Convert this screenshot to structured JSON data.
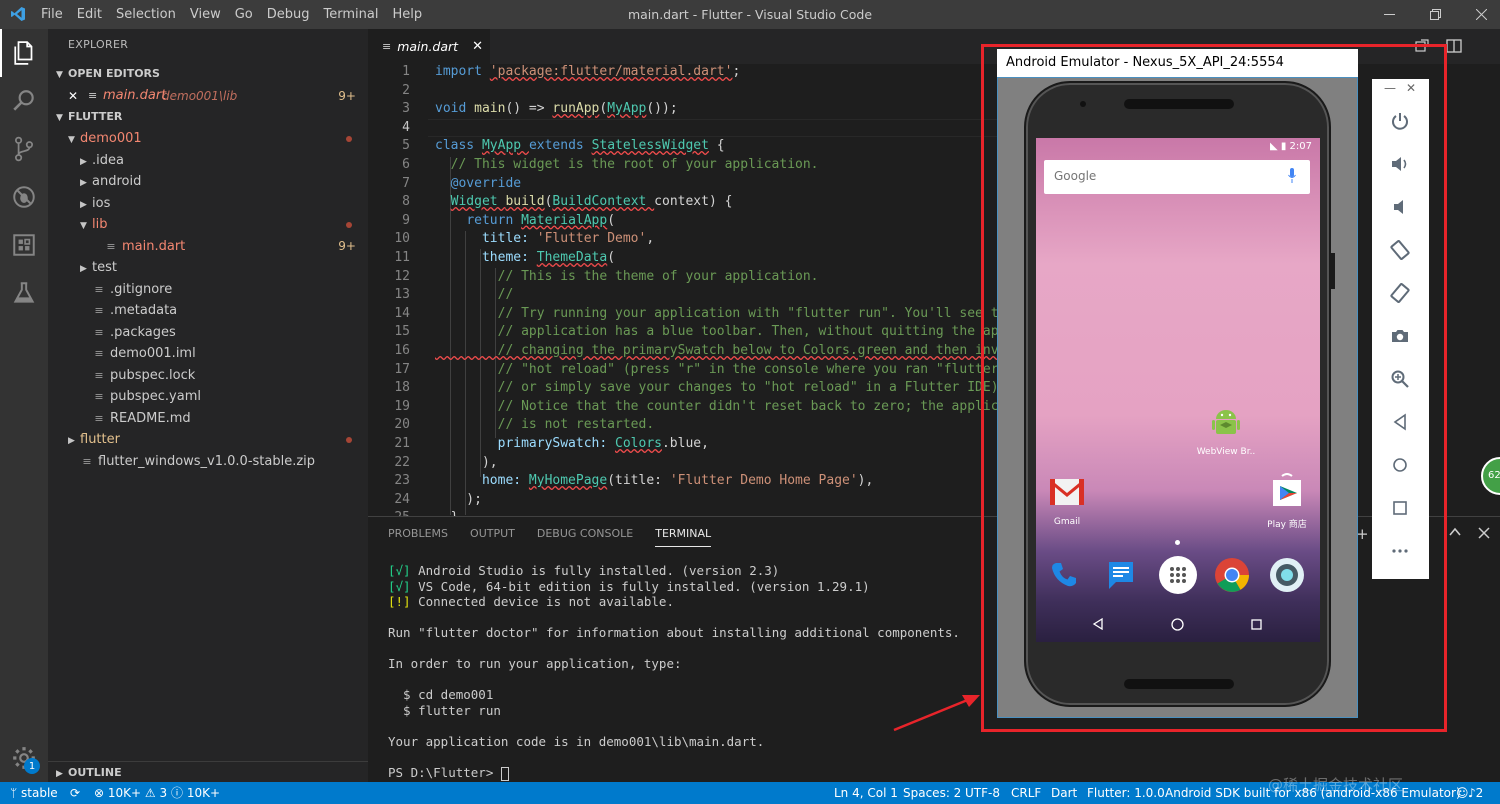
{
  "titlebar": {
    "menu": [
      "File",
      "Edit",
      "Selection",
      "View",
      "Go",
      "Debug",
      "Terminal",
      "Help"
    ],
    "title": "main.dart - Flutter - Visual Studio Code"
  },
  "sidebar": {
    "title": "EXPLORER",
    "open_editors_label": "OPEN EDITORS",
    "open_editor": {
      "name": "main.dart",
      "path": "demo001\\lib",
      "badge": "9+"
    },
    "flutter_label": "FLUTTER",
    "outline_label": "OUTLINE",
    "tree": [
      {
        "name": "demo001",
        "indent": 1,
        "type": "folder-open",
        "color": "red",
        "dot": true
      },
      {
        "name": ".idea",
        "indent": 2,
        "type": "folder"
      },
      {
        "name": "android",
        "indent": 2,
        "type": "folder"
      },
      {
        "name": "ios",
        "indent": 2,
        "type": "folder"
      },
      {
        "name": "lib",
        "indent": 2,
        "type": "folder-open",
        "color": "red",
        "dot": true
      },
      {
        "name": "main.dart",
        "indent": 3,
        "type": "file",
        "color": "red",
        "badge": "9+"
      },
      {
        "name": "test",
        "indent": 2,
        "type": "folder"
      },
      {
        "name": ".gitignore",
        "indent": 2,
        "type": "file"
      },
      {
        "name": ".metadata",
        "indent": 2,
        "type": "file"
      },
      {
        "name": ".packages",
        "indent": 2,
        "type": "file"
      },
      {
        "name": "demo001.iml",
        "indent": 2,
        "type": "file"
      },
      {
        "name": "pubspec.lock",
        "indent": 2,
        "type": "file"
      },
      {
        "name": "pubspec.yaml",
        "indent": 2,
        "type": "file"
      },
      {
        "name": "README.md",
        "indent": 2,
        "type": "file"
      },
      {
        "name": "flutter",
        "indent": 1,
        "type": "folder",
        "color": "mod",
        "dot": true
      },
      {
        "name": "flutter_windows_v1.0.0-stable.zip",
        "indent": 1,
        "type": "file"
      }
    ],
    "accounts_badge": "1"
  },
  "tab": {
    "label": "main.dart"
  },
  "editor": {
    "lines": [
      [
        "import ",
        "kw",
        "'package:flutter/material.dart'",
        "str",
        ";",
        ""
      ],
      [],
      [
        "void ",
        "kw",
        "main",
        "fn",
        "() => ",
        "",
        "runApp",
        "fn",
        "(",
        "",
        "MyApp",
        "ty",
        "());",
        ""
      ],
      [],
      [
        "class ",
        "kw",
        "MyApp ",
        "ty",
        "extends ",
        "kw",
        "StatelessWidget",
        "ty",
        " {",
        ""
      ],
      [
        "  // This widget is the root of your application.",
        "cm"
      ],
      [
        "  ",
        "",
        "@override",
        "kw"
      ],
      [
        "  ",
        "",
        "Widget ",
        "ty",
        "build",
        "fn",
        "(",
        "",
        "BuildContext ",
        "ty",
        "context) {",
        ""
      ],
      [
        "    ",
        "",
        "return ",
        "kw",
        "MaterialApp",
        "ty",
        "(",
        ""
      ],
      [
        "      title: ",
        "pm",
        "'Flutter Demo'",
        "str",
        ",",
        ""
      ],
      [
        "      theme: ",
        "pm",
        "ThemeData",
        "ty",
        "(",
        ""
      ],
      [
        "        // This is the theme of your application.",
        "cm"
      ],
      [
        "        //",
        "cm"
      ],
      [
        "        // Try running your application with \"flutter run\". You'll see the",
        "cm"
      ],
      [
        "        // application has a blue toolbar. Then, without quitting the app,",
        "cm"
      ],
      [
        "        // changing the primarySwatch below to Colors.green and then invoke",
        "cm"
      ],
      [
        "        // \"hot reload\" (press \"r\" in the console where you ran \"flutter ru",
        "cm"
      ],
      [
        "        // or simply save your changes to \"hot reload\" in a Flutter IDE).",
        "cm"
      ],
      [
        "        // Notice that the counter didn't reset back to zero; the applicati",
        "cm"
      ],
      [
        "        // is not restarted.",
        "cm"
      ],
      [
        "        primarySwatch: ",
        "pm",
        "Colors",
        "ty",
        ".blue,",
        ""
      ],
      [
        "      ),",
        ""
      ],
      [
        "      home: ",
        "pm",
        "MyHomePage",
        "ty",
        "(title: ",
        "",
        "'Flutter Demo Home Page'",
        "str",
        "),",
        ""
      ],
      [
        "    );",
        ""
      ],
      [
        "  }",
        ""
      ]
    ]
  },
  "panel": {
    "tabs": [
      "PROBLEMS",
      "OUTPUT",
      "DEBUG CONSOLE",
      "TERMINAL"
    ],
    "active_tab": "TERMINAL",
    "terminal": [
      [
        "[√]",
        "tgreen",
        " Android Studio is fully installed. (version 2.3)",
        ""
      ],
      [
        "[√]",
        "tgreen",
        " VS Code, 64-bit edition is fully installed. (version 1.29.1)",
        ""
      ],
      [
        "[!]",
        "tyellow",
        " Connected device is not available.",
        ""
      ],
      [],
      [
        "Run \"flutter doctor\" for information about installing additional components.",
        ""
      ],
      [],
      [
        "In order to run your application, type:",
        ""
      ],
      [],
      [
        "  $ cd demo001",
        ""
      ],
      [
        "  $ flutter run",
        ""
      ],
      [],
      [
        "Your application code is in demo001\\lib\\main.dart.",
        ""
      ],
      [],
      [
        "PS D:\\Flutter> ",
        ""
      ]
    ]
  },
  "statusbar": {
    "branch": "stable",
    "errors": "10K+",
    "warnings": "3",
    "infos": "10K+",
    "position": "Ln 4, Col 1",
    "spaces": "Spaces: 2",
    "encoding": "UTF-8",
    "eol": "CRLF",
    "language": "Dart",
    "flutter": "Flutter: 1.0.0",
    "device": "Android SDK built for x86 (android-x86 Emulator)",
    "notifications": "2"
  },
  "emulator": {
    "title": "Android Emulator - Nexus_5X_API_24:5554",
    "clock": "2:07",
    "google_label": "Google",
    "apps": {
      "webview": "WebView Br..",
      "gmail": "Gmail",
      "play": "Play 商店"
    },
    "toolbar": [
      "power-icon",
      "volume-up-icon",
      "volume-down-icon",
      "rotate-left-icon",
      "rotate-right-icon",
      "camera-icon",
      "zoom-icon",
      "back-icon",
      "home-icon",
      "overview-icon",
      "more-icon"
    ]
  },
  "overlay": {
    "side_badge": "62"
  },
  "watermark": "@稀土掘金技术社区",
  "colors": {
    "statusbar": "#007acc",
    "annotation": "#e8242a",
    "activity_bar": "#333333",
    "sidebar": "#252526"
  }
}
